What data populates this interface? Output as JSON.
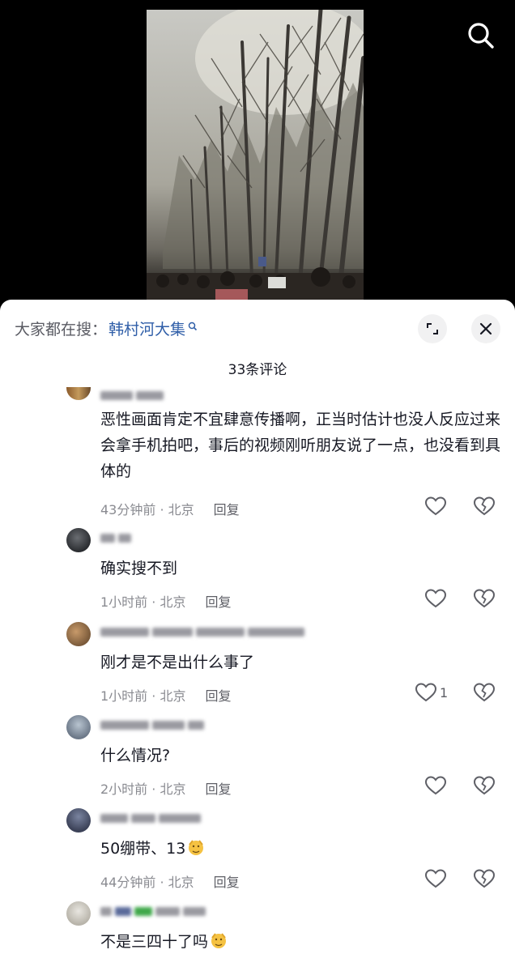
{
  "video": {
    "search_icon": "search-icon"
  },
  "sheet": {
    "trending_label": "大家都在搜：",
    "trending_keyword": "韩村河大集",
    "expand_icon": "expand-icon",
    "close_icon": "close-icon",
    "comment_count_title": "33条评论"
  },
  "comments": [
    {
      "text": "恶性画面肯定不宜肆意传播啊，正当时估计也没人反应过来会拿手机拍吧，事后的视频刚听朋友说了一点，也没看到具体的",
      "time_location": "43分钟前 · 北京",
      "reply": "回复",
      "likes": ""
    },
    {
      "text": "确实搜不到",
      "time_location": "1小时前 · 北京",
      "reply": "回复",
      "likes": ""
    },
    {
      "text": "刚才是不是出什么事了",
      "time_location": "1小时前 · 北京",
      "reply": "回复",
      "likes": "1"
    },
    {
      "text": "什么情况?",
      "time_location": "2小时前 · 北京",
      "reply": "回复",
      "likes": ""
    },
    {
      "text": "50绷带、13",
      "time_location": "44分钟前 · 北京",
      "reply": "回复",
      "likes": ""
    },
    {
      "text": "不是三四十了吗",
      "time_location": "",
      "reply": "",
      "likes": ""
    }
  ]
}
